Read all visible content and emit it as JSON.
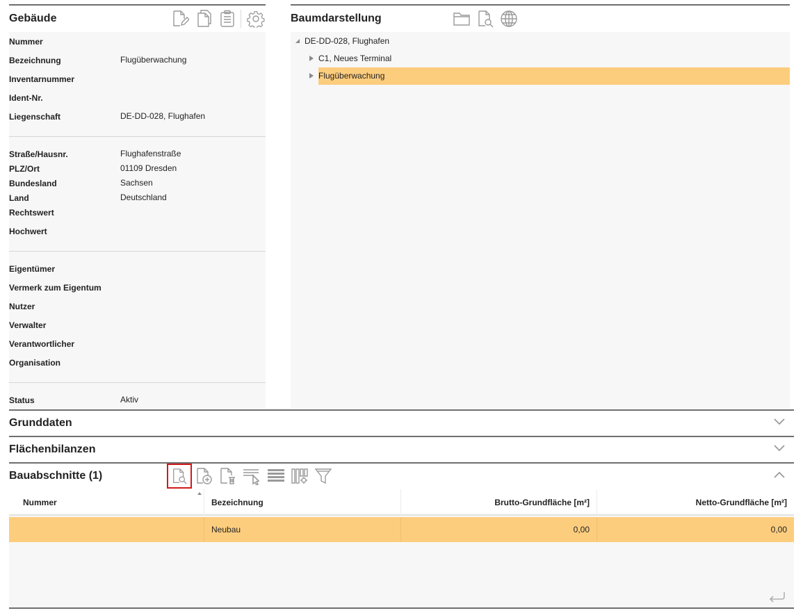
{
  "gebaeude": {
    "title": "Gebäude",
    "fields": [
      {
        "label": "Nummer",
        "value": ""
      },
      {
        "label": "Bezeichnung",
        "value": "Flugüberwachung"
      },
      {
        "label": "Inventarnummer",
        "value": ""
      },
      {
        "label": "Ident-Nr.",
        "value": ""
      },
      {
        "label": "Liegenschaft",
        "value": "DE-DD-028, Flughafen"
      }
    ],
    "address": [
      {
        "label": "Straße/Hausnr.",
        "value": "Flughafenstraße"
      },
      {
        "label": "PLZ/Ort",
        "value": "01109 Dresden"
      },
      {
        "label": "Bundesland",
        "value": "Sachsen"
      },
      {
        "label": "Land",
        "value": "Deutschland"
      },
      {
        "label": "Rechtswert",
        "value": ""
      },
      {
        "label": "Hochwert",
        "value": ""
      }
    ],
    "ownership": [
      {
        "label": "Eigentümer",
        "value": ""
      },
      {
        "label": "Vermerk zum Eigentum",
        "value": ""
      },
      {
        "label": "Nutzer",
        "value": ""
      },
      {
        "label": "Verwalter",
        "value": ""
      },
      {
        "label": "Verantwortlicher",
        "value": ""
      },
      {
        "label": "Organisation",
        "value": ""
      }
    ],
    "status": {
      "label": "Status",
      "value": "Aktiv"
    },
    "toolbar_icons": [
      "edit-document-icon",
      "copy-document-icon",
      "clipboard-icon",
      "gear-icon"
    ]
  },
  "baum": {
    "title": "Baumdarstellung",
    "toolbar_icons": [
      "folder-icon",
      "document-search-icon",
      "globe-icon"
    ],
    "root": "DE-DD-028, Flughafen",
    "children": [
      {
        "label": "C1, Neues Terminal",
        "selected": false
      },
      {
        "label": "Flugüberwachung",
        "selected": true
      }
    ]
  },
  "sections": {
    "grunddaten": "Grunddaten",
    "flaechenbilanzen": "Flächenbilanzen",
    "bauabschnitte": "Bauabschnitte (1)"
  },
  "bauabschnitte": {
    "toolbar_icons": [
      "document-search-icon",
      "document-add-icon",
      "document-delete-icon",
      "row-select-icon",
      "rows-icon",
      "columns-config-icon",
      "filter-icon"
    ],
    "columns": [
      "Nummer",
      "Bezeichnung",
      "Brutto-Grundfläche [m²]",
      "Netto-Grundfläche [m²]"
    ],
    "rows": [
      [
        "",
        "Neubau",
        "0,00",
        "0,00"
      ]
    ]
  },
  "colors": {
    "selection": "#fdcd7e",
    "border_dark": "#6e6e6e",
    "panel_bg": "#f7f7f7",
    "icon_gray": "#9a9a9a",
    "highlight_red": "#d11919"
  }
}
